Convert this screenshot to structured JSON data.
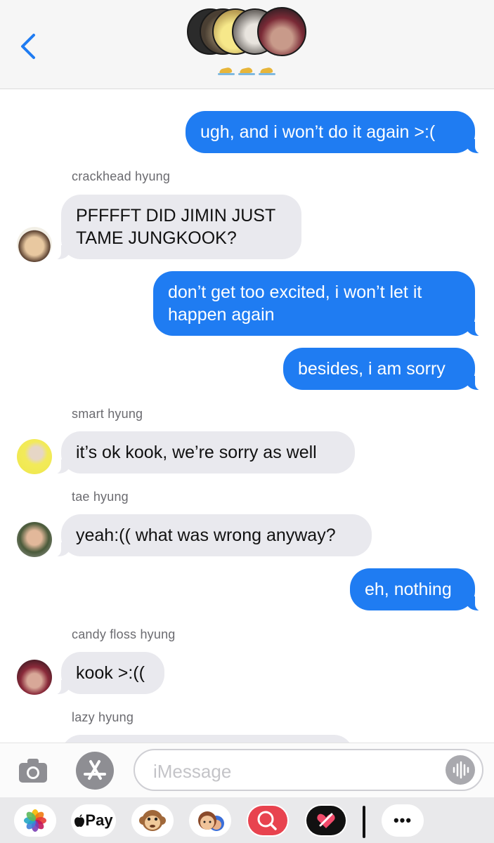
{
  "header": {
    "back_label": "<",
    "group_avatar_count": 5
  },
  "messages": [
    {
      "direction": "out",
      "text": "ugh, and i won’t do it again >:("
    },
    {
      "direction": "in",
      "sender": "crackhead hyung",
      "lines": [
        "PFFFFT DID JIMIN JUST",
        "TAME JUNGKOOK?"
      ]
    },
    {
      "direction": "out",
      "lines": [
        "don’t get too excited, i won’t let it",
        "happen again"
      ]
    },
    {
      "direction": "out",
      "text": "besides, i am sorry"
    },
    {
      "direction": "in",
      "sender": "smart hyung",
      "text": "it’s ok kook, we’re sorry as well"
    },
    {
      "direction": "in",
      "sender": "tae hyung",
      "text": "yeah:(( what was wrong anyway?"
    },
    {
      "direction": "out",
      "text": "eh, nothing"
    },
    {
      "direction": "in",
      "sender": "candy floss hyung",
      "text": "kook >:(("
    },
    {
      "direction": "in",
      "sender": "lazy hyung",
      "text": ""
    }
  ],
  "input": {
    "placeholder": "iMessage",
    "value": ""
  },
  "app_drawer": {
    "apple_pay_label": "Pay",
    "more_label": "•••"
  },
  "colors": {
    "outgoing_bubble": "#1f7cf2",
    "incoming_bubble": "#e9e9ee",
    "header_bg": "#f6f6f6",
    "drawer_bg": "#e9e9eb"
  },
  "icons": [
    "back-chevron-icon",
    "camera-icon",
    "app-store-icon",
    "audio-waveform-icon",
    "photos-icon",
    "apple-pay-icon",
    "monkey-animoji-icon",
    "memoji-icon",
    "image-search-icon",
    "digital-touch-icon",
    "more-icon"
  ]
}
